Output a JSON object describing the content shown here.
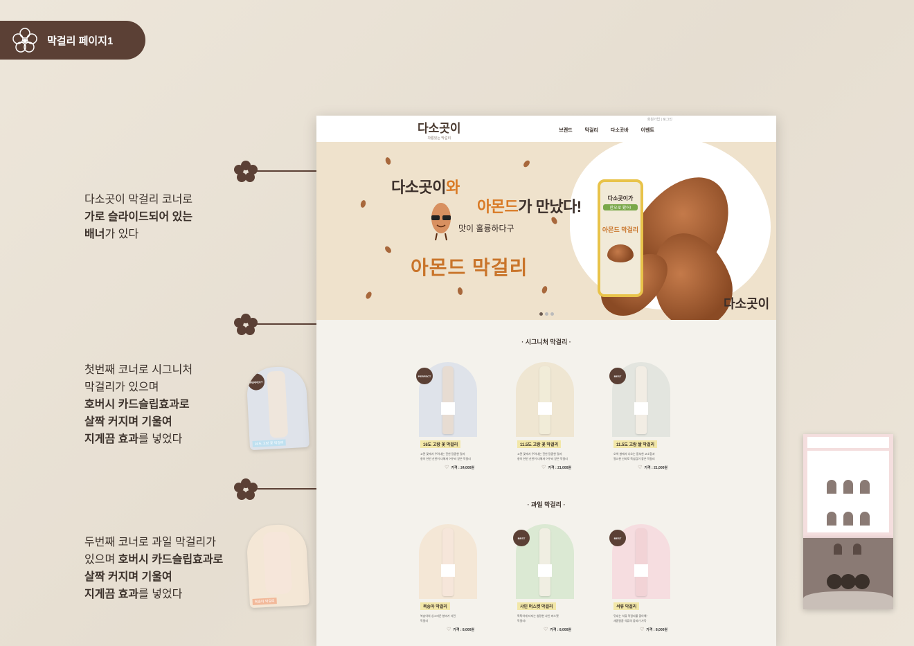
{
  "header": {
    "title": "막걸리 페이지1"
  },
  "notes": {
    "n1": {
      "line1": "다소곳이 막걸리 코너로",
      "line2": "가로 슬라이드되어 있는",
      "line3_bold": "배너",
      "line3_rest": "가 있다"
    },
    "n2": {
      "line1": "첫번째 코너로 시그니처",
      "line2": "막걸리가 있으며",
      "line3": "호버시 카드슬립효과로",
      "line4": "살짝 커지며 기울여",
      "line5_bold": "지게끔 효과",
      "line5_rest": "를 넣었다"
    },
    "n3": {
      "line1": "두번째 코너로 과일 막걸리가",
      "line2_a": "있으며 ",
      "line2_bold": "호버시 카드슬립효과로",
      "line3": "살짝 커지며 기울여",
      "line4_bold": "지게끔 효과",
      "line4_rest": "를 넣었다"
    }
  },
  "thumbs": {
    "t1": {
      "tag": "PERFECT",
      "label": "16도 고랑 꽃 막걸리"
    },
    "t2": {
      "label": "복숭아 막걸리"
    }
  },
  "site": {
    "logo": "다소곳이",
    "logo_sub": "자릉있는 막걸리",
    "util": "회원가입 | 로그인",
    "nav": [
      "브랜드",
      "막걸리",
      "다소곳바",
      "이벤트"
    ],
    "banner": {
      "h1_a": "다소곳이",
      "h1_b": "와",
      "h2_a": "아몬드",
      "h2_b": "가 만났다!",
      "sub": "맛이 훌륭하다구",
      "big": "아몬드 막걸리",
      "can_t1": "다소곳이가",
      "can_t2": "한오로 왔어!",
      "can_t3": "아몬드 막걸리",
      "signature": "다소곳이"
    },
    "signature_section": {
      "title": "· 시그니처 막걸리 ·",
      "cards": [
        {
          "tag": "PERFECT",
          "name": "16도 고랑 꽃 막걸리",
          "desc1": "고관 꽃에서 우려내는 진한 달콤한 맛과",
          "desc2": "향이 한번 산번이 더해져 어우러 같은 막걸리",
          "price": "가격 : 24,000원",
          "bg": "#dfe3ea",
          "bottle": "#e7dcd2"
        },
        {
          "tag": "",
          "name": "11.5도 고랑 꽃 막걸리",
          "desc1": "고관 꽃에서 우려내는 진한 달콤한 맛과",
          "desc2": "향이 한번 산번이 더해져 어우러 같은 막걸리",
          "price": "가격 : 21,000원",
          "bg": "#efe6d2",
          "bottle": "#f1ecd8"
        },
        {
          "tag": "BEST",
          "name": "11.5도 고랑 쌀 막걸리",
          "desc1": "오색 쌀에서 나오는 풍부한 고소함과",
          "desc2": "껄끄한 선미로 목넘김이 좋은 막걸리",
          "price": "가격 : 21,000원",
          "bg": "#e3e5df",
          "bottle": "#f2ede4"
        }
      ]
    },
    "fruit_section": {
      "title": "· 과일 막걸리 ·",
      "cards": [
        {
          "tag": "",
          "name": "복숭아 막걸리",
          "desc1": "복숭아의 싱그러운 향미가 서린",
          "desc2": "막걸리",
          "price": "가격 : 8,000원",
          "bg": "#f4e7d6",
          "bottle": "#f6e6da"
        },
        {
          "tag": "BEST",
          "name": "샤인 머스켓 막걸리",
          "desc1": "톡톡하게 터지는 청량한 샤인 머스켓",
          "desc2": "막걸리!",
          "price": "가격 : 8,000원",
          "bg": "#dbe9d3",
          "bottle": "#f0eee2"
        },
        {
          "tag": "BEST",
          "name": "석류 막걸리",
          "desc1": "뒤내는 석류 막걸리를 좋아해~",
          "desc2": "새콤달콤 석류의 꽃피가 가득",
          "price": "가격 : 8,000원",
          "bg": "#f6dde0",
          "bottle": "#f2d3d6"
        }
      ]
    }
  },
  "colors": {
    "brown": "#5b4035",
    "accent": "#d97a25",
    "banner_bg": "#efe2cc"
  }
}
